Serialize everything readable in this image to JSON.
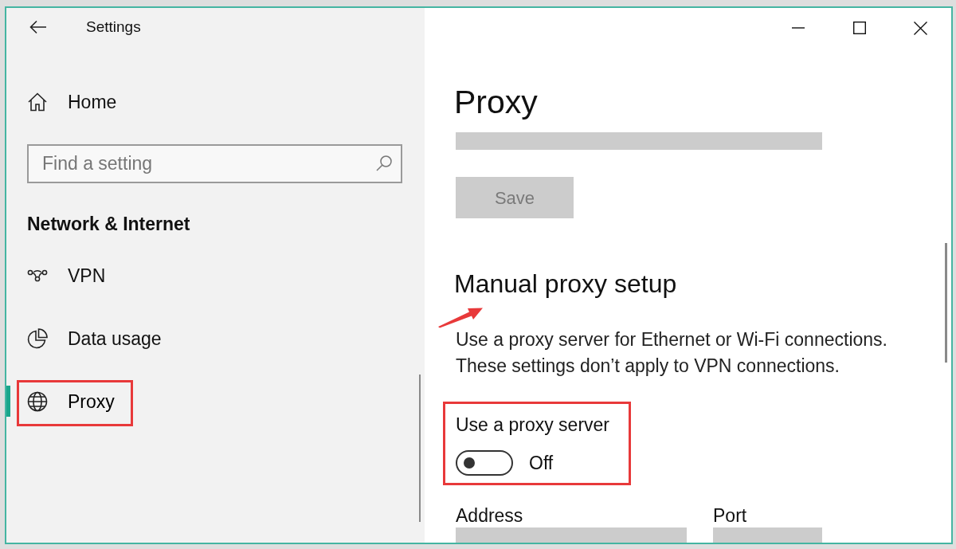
{
  "window": {
    "title": "Settings"
  },
  "sidebar": {
    "home": {
      "label": "Home"
    },
    "search": {
      "placeholder": "Find a setting"
    },
    "section_title": "Network & Internet",
    "items": [
      {
        "label": "VPN",
        "selected": false
      },
      {
        "label": "Data usage",
        "selected": false
      },
      {
        "label": "Proxy",
        "selected": true
      }
    ]
  },
  "content": {
    "title": "Proxy",
    "input_field": {
      "disabled": true
    },
    "save_button": {
      "label": "Save",
      "disabled": true
    },
    "manual_setup": {
      "title": "Manual proxy setup",
      "description": [
        "Use a proxy server for Ethernet or Wi-Fi connections.",
        "These settings don’t apply to VPN connections."
      ],
      "proxy_toggle": {
        "label": "Use a proxy server",
        "on": false,
        "state_text": "Off"
      },
      "address": {
        "label": "Address",
        "disabled": true
      },
      "port": {
        "label": "Port",
        "disabled": true
      }
    }
  }
}
